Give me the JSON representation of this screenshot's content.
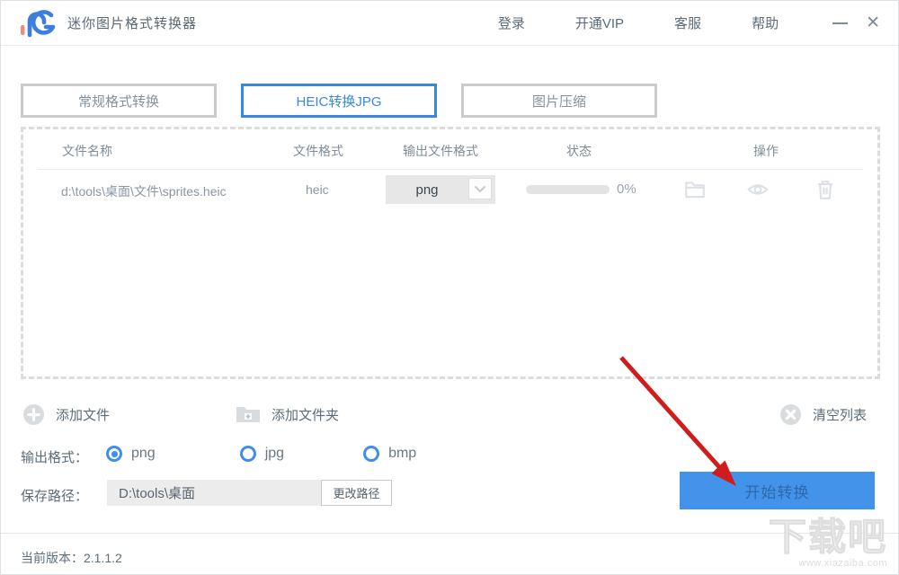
{
  "window": {
    "title": "迷你图片格式转换器",
    "menu_items": [
      {
        "label": "登录"
      },
      {
        "label": "开通VIP"
      },
      {
        "label": "客服"
      },
      {
        "label": "帮助"
      }
    ]
  },
  "tabs": [
    {
      "label": "常规格式转换",
      "active": false
    },
    {
      "label": "HEIC转换JPG",
      "active": true
    },
    {
      "label": "图片压缩",
      "active": false
    }
  ],
  "table": {
    "headers": [
      "文件名称",
      "文件格式",
      "输出文件格式",
      "状态",
      "操作"
    ],
    "rows": [
      {
        "filename": "d:\\tools\\桌面\\文件\\sprites.heic",
        "format": "heic",
        "output_format": "png",
        "progress_text": "0%",
        "progress_value": 0
      }
    ]
  },
  "actions": {
    "add_file": "添加文件",
    "add_folder": "添加文件夹",
    "clear_list": "清空列表"
  },
  "output_format": {
    "label": "输出格式：",
    "options": [
      {
        "label": "png",
        "selected": true
      },
      {
        "label": "jpg",
        "selected": false
      },
      {
        "label": "bmp",
        "selected": false
      }
    ]
  },
  "save_path": {
    "label": "保存路径：",
    "value": "D:\\tools\\桌面",
    "change_button": "更改路径"
  },
  "convert": {
    "label": "开始转换"
  },
  "footer": {
    "version": "当前版本：2.1.1.2"
  },
  "watermark": {
    "title": "下载吧",
    "url": "www.xiazaiba.com"
  },
  "colors": {
    "accent_blue": "#3a87e0",
    "button_blue": "#4493ea",
    "arrow_red": "#cf1d1d",
    "icon_gray": "#d8dcdf"
  }
}
